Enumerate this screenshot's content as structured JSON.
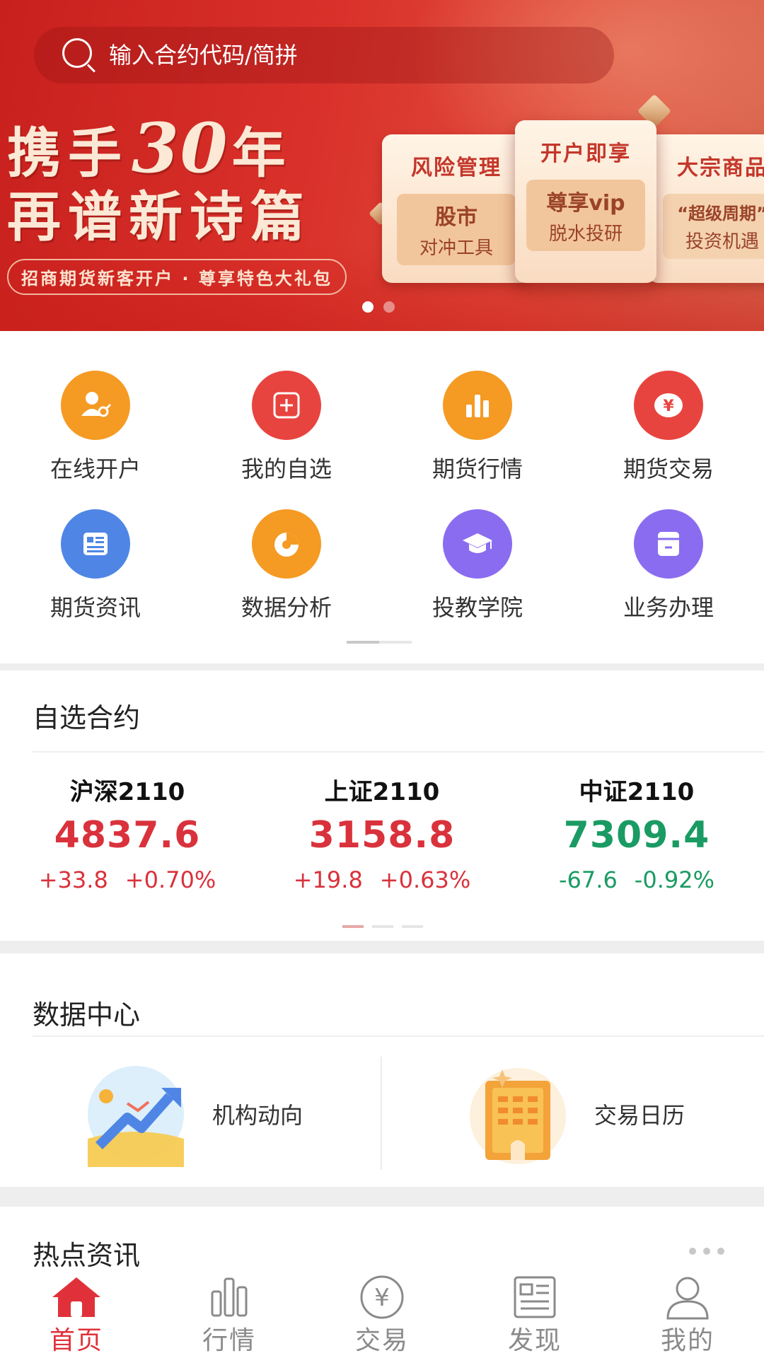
{
  "search": {
    "placeholder": "输入合约代码/简拼"
  },
  "banner": {
    "headline_line1_a": "携手",
    "headline_30": "30",
    "headline_line1_b": "年",
    "headline_line2": "再谱新诗篇",
    "subline": "招商期货新客开户 · 尊享特色大礼包",
    "cards": [
      {
        "title": "风险管理",
        "line1": "股市",
        "line2": "对冲工具"
      },
      {
        "title": "开户即享",
        "line1": "尊享vip",
        "line2": "脱水投研"
      },
      {
        "title": "大宗商品",
        "line1": "“超级周期”",
        "line2": "投资机遇"
      }
    ],
    "pager": {
      "count": 2,
      "active": 0
    }
  },
  "grid": {
    "items": [
      {
        "label": "在线开户",
        "icon": "open-account-icon",
        "color": "#f59a23"
      },
      {
        "label": "我的自选",
        "icon": "add-favorite-icon",
        "color": "#e8443f"
      },
      {
        "label": "期货行情",
        "icon": "bar-chart-icon",
        "color": "#f59a23"
      },
      {
        "label": "期货交易",
        "icon": "yuan-coin-icon",
        "color": "#e8443f"
      },
      {
        "label": "期货资讯",
        "icon": "news-icon",
        "color": "#4f86e6"
      },
      {
        "label": "数据分析",
        "icon": "pie-chart-icon",
        "color": "#f59a23"
      },
      {
        "label": "投教学院",
        "icon": "graduation-cap-icon",
        "color": "#8a6cf0"
      },
      {
        "label": "业务办理",
        "icon": "document-bag-icon",
        "color": "#8a6cf0"
      }
    ]
  },
  "watchlist": {
    "title": "自选合约",
    "quotes": [
      {
        "name": "沪深2110",
        "price": "4837.6",
        "change": "+33.8",
        "pct": "+0.70%",
        "dir": "up"
      },
      {
        "name": "上证2110",
        "price": "3158.8",
        "change": "+19.8",
        "pct": "+0.63%",
        "dir": "up"
      },
      {
        "name": "中证2110",
        "price": "7309.4",
        "change": "-67.6",
        "pct": "-0.92%",
        "dir": "down"
      }
    ]
  },
  "datacenter": {
    "title": "数据中心",
    "items": [
      {
        "label": "机构动向",
        "icon": "trend-arrow-icon"
      },
      {
        "label": "交易日历",
        "icon": "calendar-icon"
      }
    ]
  },
  "news": {
    "title": "热点资讯"
  },
  "tabbar": {
    "active": "首页",
    "tabs": [
      {
        "label": "首页",
        "icon": "home-icon"
      },
      {
        "label": "行情",
        "icon": "market-bars-icon"
      },
      {
        "label": "交易",
        "icon": "trade-yuan-icon"
      },
      {
        "label": "发现",
        "icon": "discover-news-icon"
      },
      {
        "label": "我的",
        "icon": "profile-icon"
      }
    ]
  },
  "colors": {
    "brand_red": "#e0313a",
    "up": "#d9323c",
    "down": "#1a9b63",
    "tab_inactive": "#8a8a8a"
  }
}
